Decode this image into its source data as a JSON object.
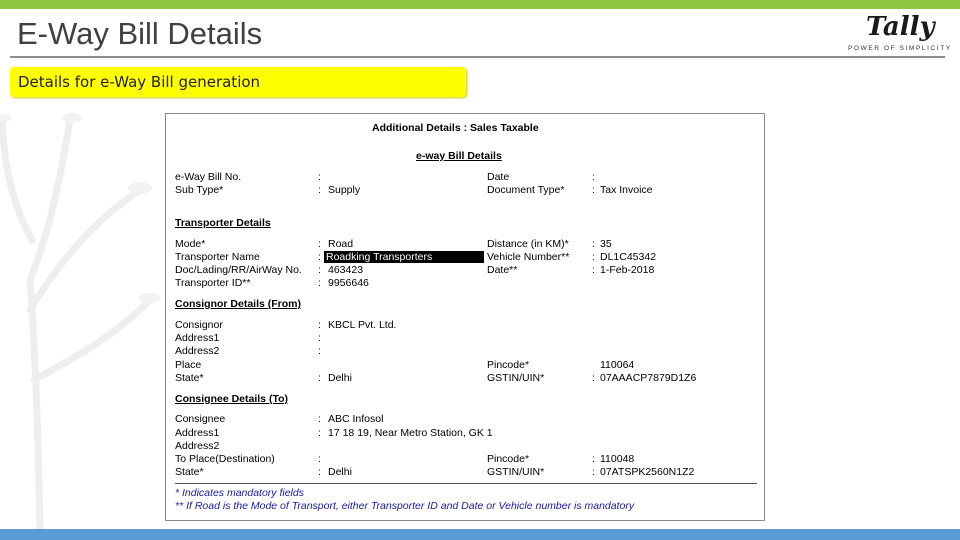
{
  "slide": {
    "title": "E-Way Bill Details",
    "subtitle": "Details for e-Way Bill generation",
    "logo": {
      "word": "Tally",
      "tagline": "POWER OF SIMPLICITY"
    },
    "colors": {
      "top_bar": "#8dc63f",
      "bottom_bar": "#5b9bd5",
      "highlight": "#ffff00"
    }
  },
  "screen": {
    "header": "Additional Details : Sales Taxable",
    "section_title": "e-way Bill Details",
    "eway_bill_no_label": "e-Way Bill No.",
    "eway_bill_no_value": "",
    "date_label": "Date",
    "date_value": "",
    "sub_type_label": "Sub Type*",
    "sub_type_value": "Supply",
    "document_type_label": "Document Type*",
    "document_type_value": "Tax Invoice",
    "transporter_heading": "Transporter Details",
    "mode_label": "Mode*",
    "mode_value": "Road",
    "distance_label": "Distance (in KM)*",
    "distance_value": "35",
    "transporter_name_label": "Transporter Name",
    "transporter_name_value": "Roadking Transporters",
    "vehicle_number_label": "Vehicle Number**",
    "vehicle_number_value": "DL1C45342",
    "doc_no_label": "Doc/Lading/RR/AirWay No.",
    "doc_no_value": "463423",
    "doc_date_label": "Date**",
    "doc_date_value": "1-Feb-2018",
    "transporter_id_label": "Transporter ID**",
    "transporter_id_value": "9956646",
    "consignor_heading": "Consignor Details (From)",
    "consignor_label": "Consignor",
    "consignor_value": "KBCL Pvt. Ltd.",
    "consignor_address1_label": "Address1",
    "consignor_address2_label": "Address2",
    "consignor_place_label": "Place",
    "consignor_pincode_label": "Pincode*",
    "consignor_pincode_value": "110064",
    "consignor_state_label": "State*",
    "consignor_state_value": "Delhi",
    "consignor_gstin_label": "GSTIN/UIN*",
    "consignor_gstin_value": "07AAACP7879D1Z6",
    "consignee_heading": "Consignee Details (To)",
    "consignee_label": "Consignee",
    "consignee_value": "ABC Infosol",
    "consignee_address1_label": "Address1",
    "consignee_address1_value": "17 18 19, Near Metro Station, GK 1",
    "consignee_address2_label": "Address2",
    "consignee_place_label": "To Place(Destination)",
    "consignee_pincode_label": "Pincode*",
    "consignee_pincode_value": "110048",
    "consignee_state_label": "State*",
    "consignee_state_value": "Delhi",
    "consignee_gstin_label": "GSTIN/UIN*",
    "consignee_gstin_value": "07ATSPK2560N1Z2",
    "colon": ":",
    "note1": "* Indicates mandatory fields",
    "note2": "** If Road is the Mode of Transport, either Transporter ID and Date or Vehicle number is mandatory"
  }
}
